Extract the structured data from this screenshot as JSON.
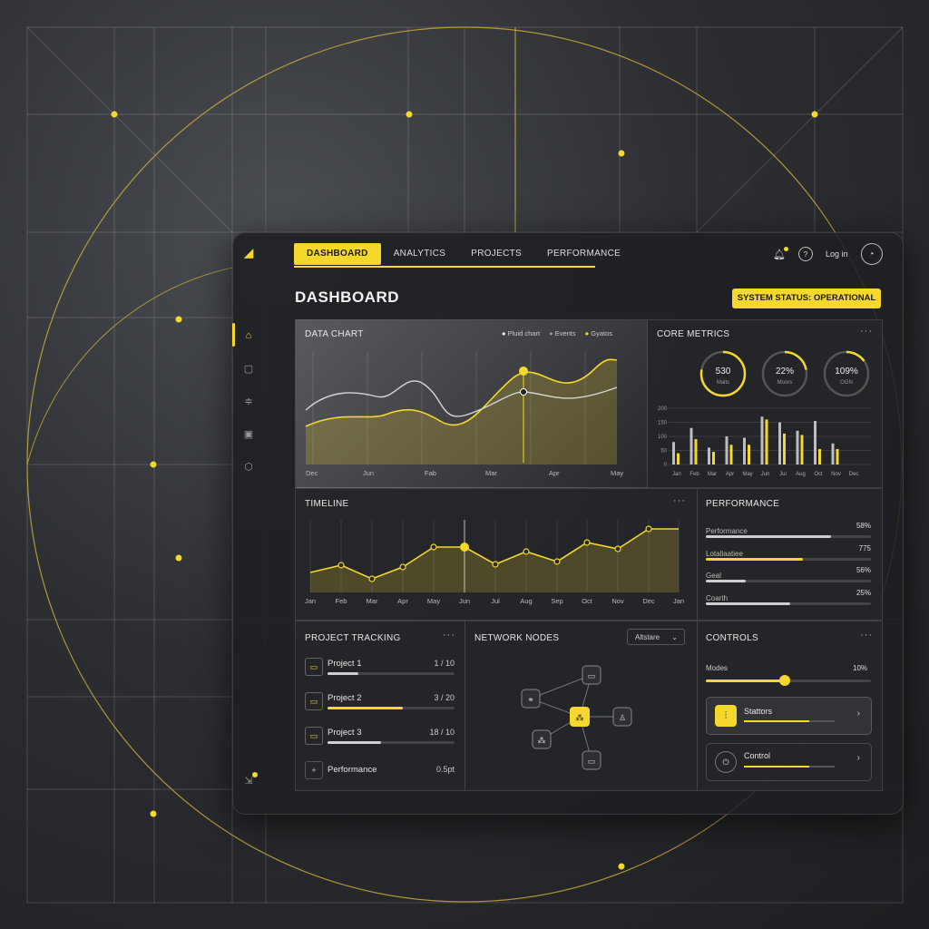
{
  "colors": {
    "accent": "#f5d82b",
    "bg": "#1e1f22",
    "panel": "#26272a"
  },
  "nav": {
    "tabs": [
      "DASHBOARD",
      "ANALYTICS",
      "PROJECTS",
      "PERFORMANCE"
    ],
    "login": "Log in"
  },
  "page_title": "DASHBOARD",
  "status": "SYSTEM STATUS: OPERATIONAL",
  "sidebar_icons": [
    "logo-icon",
    "home-icon",
    "clipboard-icon",
    "sliders-icon",
    "image-icon",
    "cube-icon",
    "export-icon"
  ],
  "data_chart": {
    "title": "DATA CHART",
    "legend": [
      "Pluid chart",
      "Events",
      "Gyatos"
    ],
    "months": [
      "Dec",
      "Jun",
      "Fab",
      "Mar",
      "Apr",
      "May"
    ]
  },
  "core_metrics": {
    "title": "CORE METRICS",
    "rings": [
      {
        "value": "530",
        "label": "Malts",
        "pct": 0.78
      },
      {
        "value": "22%",
        "label": "Moors",
        "pct": 0.22
      },
      {
        "value": "109%",
        "label": "OGN",
        "pct": 0.15
      }
    ],
    "yticks": [
      "200",
      "150",
      "100",
      "50",
      "0"
    ],
    "months": [
      "Jan",
      "Feb",
      "Mar",
      "Apr",
      "May",
      "Jun",
      "Jul",
      "Aug",
      "Oct",
      "Nov",
      "Dec"
    ],
    "series_grey": [
      80,
      130,
      60,
      100,
      95,
      170,
      150,
      120,
      155,
      75
    ],
    "series_yellow": [
      40,
      90,
      45,
      70,
      70,
      160,
      110,
      105,
      55,
      55
    ]
  },
  "timeline": {
    "title": "TIMELINE",
    "months": [
      "Jan",
      "Feb",
      "Mar",
      "Apr",
      "May",
      "Jun",
      "Jul",
      "Aug",
      "Sep",
      "Oct",
      "Nov",
      "Dec",
      "Jan"
    ]
  },
  "performance": {
    "title": "PERFORMANCE",
    "rows": [
      {
        "label": "Performance",
        "value": "58%",
        "pct": 0.76,
        "color": "#cfcfcf"
      },
      {
        "label": "Lotallaatiee",
        "value": "775",
        "pct": 0.59,
        "color": "#f5d82b"
      },
      {
        "label": "Geal",
        "value": "56%",
        "pct": 0.24,
        "color": "#cfcfcf"
      },
      {
        "label": "Coarth",
        "value": "25%",
        "pct": 0.51,
        "color": "#cfcfcf"
      }
    ]
  },
  "projects": {
    "title": "PROJECT TRACKING",
    "items": [
      {
        "name": "Project 1",
        "value": "1 / 10",
        "pct": 0.24,
        "color": "#cfcfcf"
      },
      {
        "name": "Project 2",
        "value": "3 / 20",
        "pct": 0.59,
        "color": "#f5d82b"
      },
      {
        "name": "Project 3",
        "value": "18 / 10",
        "pct": 0.42,
        "color": "#cfcfcf"
      },
      {
        "name": "Performance",
        "value": "0.5pt"
      }
    ]
  },
  "network": {
    "title": "NETWORK NODES",
    "select": "Altstare"
  },
  "controls": {
    "title": "CONTROLS",
    "slider_label": "Modes",
    "slider_value": "10%",
    "slider_pct": 0.48,
    "buttons": [
      {
        "label": "Stattors",
        "pct": 0.72
      },
      {
        "label": "Control",
        "pct": 0.72
      }
    ]
  }
}
